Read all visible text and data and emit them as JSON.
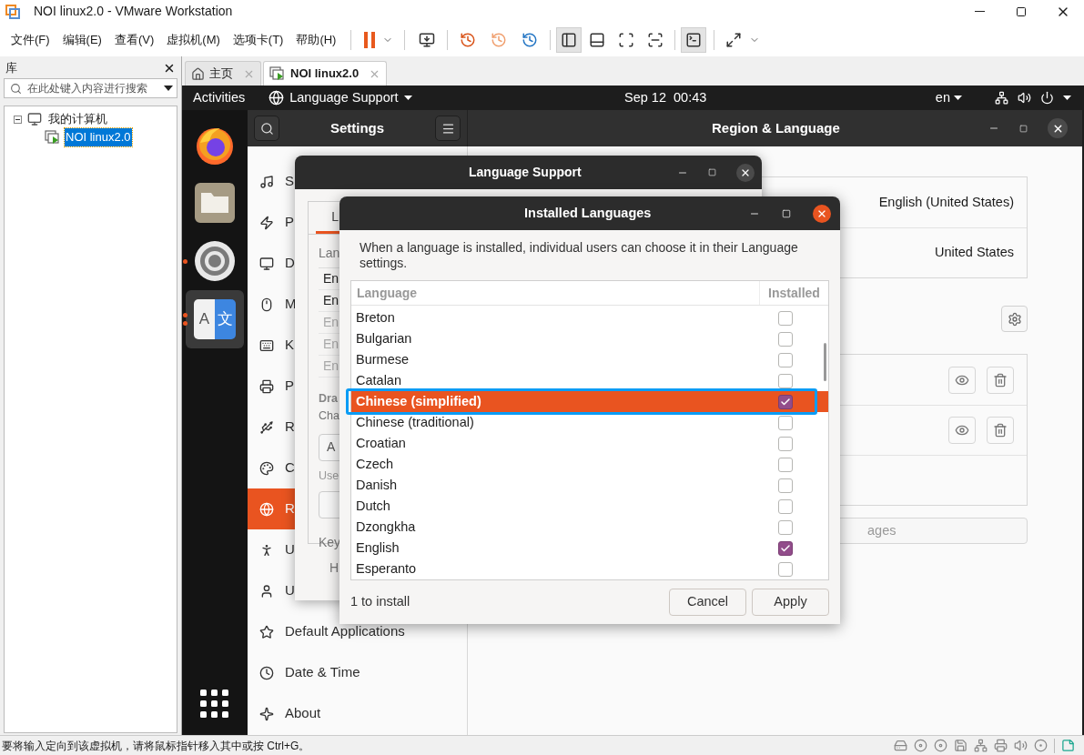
{
  "window": {
    "title": "NOI linux2.0 - VMware Workstation"
  },
  "menu": [
    "文件(F)",
    "编辑(E)",
    "查看(V)",
    "虚拟机(M)",
    "选项卡(T)",
    "帮助(H)"
  ],
  "library": {
    "title": "库",
    "search": {
      "placeholder": "在此处键入内容进行搜索"
    },
    "tree": [
      {
        "label": "我的计算机",
        "expanded": true,
        "selected": false,
        "children": [
          {
            "label": "NOI linux2.0",
            "selected": true
          }
        ]
      }
    ]
  },
  "tabs": [
    {
      "label": "主页",
      "kind": "home",
      "selected": false
    },
    {
      "label": "NOI linux2.0",
      "kind": "vm",
      "selected": true
    }
  ],
  "ubuntu": {
    "top_bar": {
      "activities": "Activities",
      "app_menu": "Language Support",
      "clock": "Sep 12  00:43",
      "input_source": "en"
    },
    "dock": [
      {
        "kind": "firefox",
        "running": false,
        "selected": false
      },
      {
        "kind": "files",
        "running": false,
        "selected": false
      },
      {
        "kind": "settings",
        "running": true,
        "multiple_windows": false,
        "selected": false
      },
      {
        "kind": "language",
        "running": true,
        "multiple_windows": true,
        "selected": true,
        "glyph_left": "A",
        "glyph_right": "文"
      }
    ],
    "settings": {
      "title": "Settings",
      "panel_title": "Region & Language",
      "sidebar": [
        {
          "kind": "sound",
          "label": "S",
          "selected": false
        },
        {
          "kind": "power",
          "label": "P",
          "selected": false
        },
        {
          "kind": "display",
          "label": "D",
          "selected": false
        },
        {
          "kind": "mouse",
          "label": "M",
          "selected": false
        },
        {
          "kind": "keyboard",
          "label": "K",
          "selected": false
        },
        {
          "kind": "printers",
          "label": "P",
          "selected": false
        },
        {
          "kind": "removable",
          "label": "R",
          "selected": false
        },
        {
          "kind": "color",
          "label": "C",
          "selected": false
        },
        {
          "kind": "region",
          "label": "R",
          "selected": true
        },
        {
          "kind": "accessibility",
          "label": "U",
          "selected": false
        },
        {
          "kind": "users",
          "label": "U",
          "selected": false
        },
        {
          "kind": "default-apps",
          "label": "Default Applications",
          "selected": false
        },
        {
          "kind": "datetime",
          "label": "Date & Time",
          "selected": false
        },
        {
          "kind": "about",
          "label": "About",
          "selected": false
        }
      ],
      "region_rows": [
        {
          "value": "English (United States)"
        },
        {
          "value": "United States"
        }
      ],
      "input_source_rows": [
        {
          "kind": "source"
        },
        {
          "kind": "source"
        },
        {
          "kind": "empty"
        }
      ],
      "manage_button": "ages"
    },
    "language_support": {
      "title": "Language Support",
      "tab": "L",
      "list_heading": "Lan",
      "languages": [
        {
          "label": "En",
          "disabled": false
        },
        {
          "label": "En",
          "disabled": false
        },
        {
          "label": "En",
          "disabled": true
        },
        {
          "label": "En",
          "disabled": true
        },
        {
          "label": "En",
          "disabled": true
        }
      ],
      "drag_title": "Dra",
      "drag_hint": "Cha",
      "install_button": "A",
      "use_hint": "Use",
      "keyboard_label": "Key",
      "help_button": "H"
    },
    "installed_languages": {
      "title": "Installed Languages",
      "description": "When a language is installed, individual users can choose it in their Language settings.",
      "columns": [
        "Language",
        "Installed"
      ],
      "rows": [
        {
          "label": "Breton",
          "checked": false,
          "selected": false,
          "annotated": false
        },
        {
          "label": "Bulgarian",
          "checked": false,
          "selected": false,
          "annotated": false
        },
        {
          "label": "Burmese",
          "checked": false,
          "selected": false,
          "annotated": false
        },
        {
          "label": "Catalan",
          "checked": false,
          "selected": false,
          "annotated": false
        },
        {
          "label": "Chinese (simplified)",
          "checked": true,
          "selected": true,
          "annotated": true
        },
        {
          "label": "Chinese (traditional)",
          "checked": false,
          "selected": false,
          "annotated": false
        },
        {
          "label": "Croatian",
          "checked": false,
          "selected": false,
          "annotated": false
        },
        {
          "label": "Czech",
          "checked": false,
          "selected": false,
          "annotated": false
        },
        {
          "label": "Danish",
          "checked": false,
          "selected": false,
          "annotated": false
        },
        {
          "label": "Dutch",
          "checked": false,
          "selected": false,
          "annotated": false
        },
        {
          "label": "Dzongkha",
          "checked": false,
          "selected": false,
          "annotated": false
        },
        {
          "label": "English",
          "checked": true,
          "selected": false,
          "annotated": false
        },
        {
          "label": "Esperanto",
          "checked": false,
          "selected": false,
          "annotated": false
        }
      ],
      "status": "1 to install",
      "buttons": [
        "Cancel",
        "Apply"
      ]
    }
  },
  "status_bar": {
    "message": "要将输入定向到该虚拟机，请将鼠标指针移入其中或按 Ctrl+G。"
  }
}
